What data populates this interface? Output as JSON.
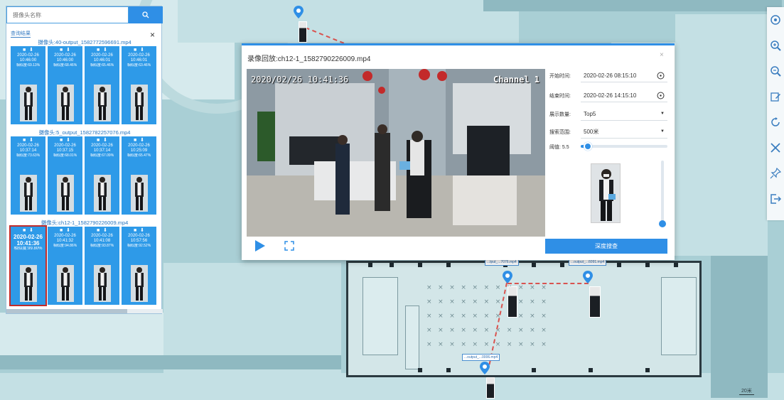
{
  "left_panel": {
    "search_placeholder": "摄像头名称",
    "result_header": "查询结果",
    "close_symbol": "×",
    "groups": [
      {
        "title": "摄像头:40-output_1582772596691.mp4",
        "cards": [
          {
            "date": "2020-02-26",
            "time": "10:46:00",
            "sim": "相似度:69.13%"
          },
          {
            "date": "2020-02-26",
            "time": "10:46:00",
            "sim": "相似度:68.46%"
          },
          {
            "date": "2020-02-26",
            "time": "10:46:01",
            "sim": "相似度:65.46%"
          },
          {
            "date": "2020-02-26",
            "time": "10:46:01",
            "sim": "相似度:63.46%"
          }
        ]
      },
      {
        "title": "摄像头:5_output_1582782257076.mp4",
        "cards": [
          {
            "date": "2020-02-26",
            "time": "10:37:14",
            "sim": "相似度:73.63%"
          },
          {
            "date": "2020-02-26",
            "time": "10:37:15",
            "sim": "相似度:68.01%"
          },
          {
            "date": "2020-02-26",
            "time": "10:37:14",
            "sim": "相似度:67.09%"
          },
          {
            "date": "2020-02-26",
            "time": "10:25:09",
            "sim": "相似度:65.47%"
          }
        ]
      },
      {
        "title": "摄像头:ch12-1_1582790226009.mp4",
        "cards": [
          {
            "date": "2020-02-26",
            "time": "10:41:36",
            "sim": "相似度:99.80%"
          },
          {
            "date": "2020-02-26",
            "time": "10:41:32",
            "sim": "相似度:94.86%"
          },
          {
            "date": "2020-02-26",
            "time": "10:41:08",
            "sim": "相似度:93.87%"
          },
          {
            "date": "2020-02-26",
            "time": "10:57:56",
            "sim": "相似度:92.52%"
          }
        ]
      }
    ]
  },
  "dialog": {
    "title": "录像回放:ch12-1_1582790226009.mp4",
    "close_symbol": "×",
    "video_timestamp": "2020/02/26 10:41:36",
    "video_channel": "Channel 1",
    "form": {
      "start_label": "开始时间:",
      "start_value": "2020-02-26 08:15:10",
      "end_label": "结束时间:",
      "end_value": "2020-02-26 14:15:10",
      "display_label": "展示数量:",
      "display_value": "Top5",
      "range_label": "搜索范围:",
      "range_value": "500米",
      "threshold_label": "阈值: 5.5",
      "threshold_fraction": 0.08
    },
    "deep_search_label": "深度搜查"
  },
  "map": {
    "camera_labels": [
      "...tput_...7076.mp4",
      "...output_...6091.mp4",
      "...output_...0006.mp4"
    ],
    "scale_label": "20米"
  },
  "toolbar": {
    "icons": [
      "target-icon",
      "zoom-in-icon",
      "zoom-out-icon",
      "edit-icon",
      "refresh-icon",
      "tools-icon",
      "pin-icon",
      "exit-icon"
    ]
  },
  "colors": {
    "accent": "#2f8fe6",
    "selected_border": "#c02b2b",
    "map_bg": "#a9cfd5"
  }
}
